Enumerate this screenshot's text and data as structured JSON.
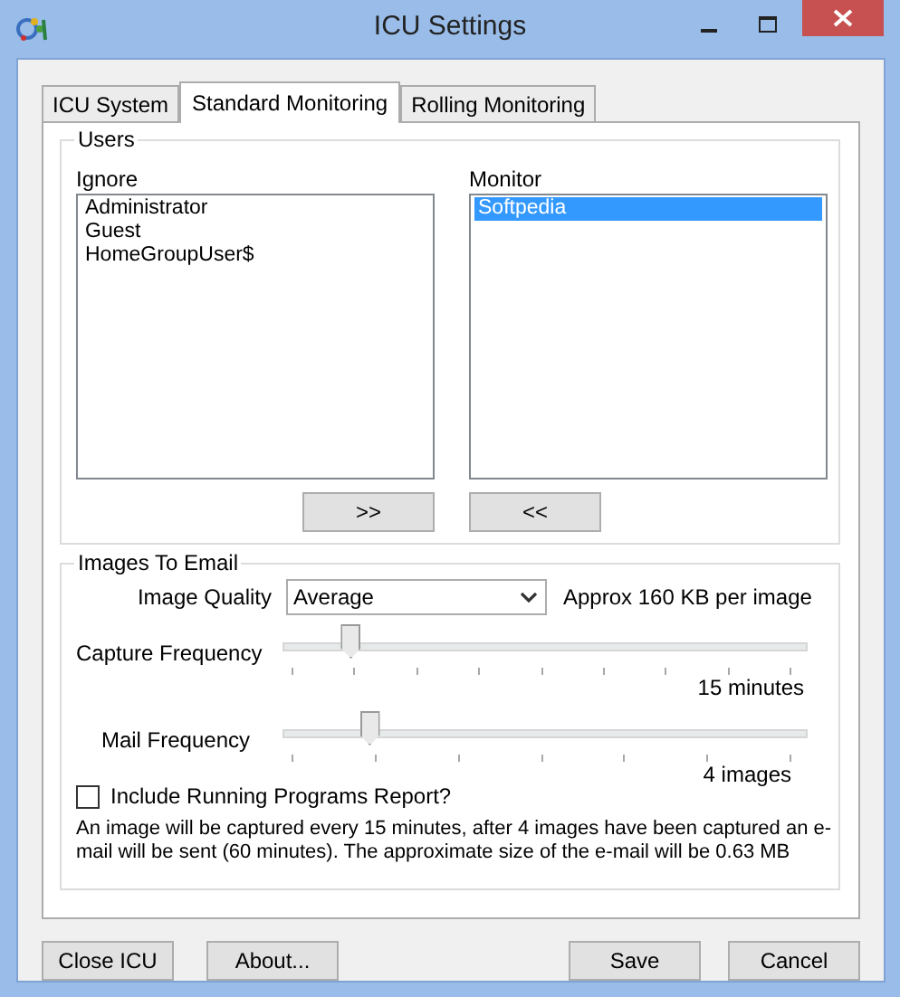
{
  "window": {
    "title": "ICU Settings"
  },
  "tabs": [
    {
      "label": "ICU System",
      "selected": false
    },
    {
      "label": "Standard Monitoring",
      "selected": true
    },
    {
      "label": "Rolling Monitoring",
      "selected": false
    }
  ],
  "users": {
    "title": "Users",
    "ignore": {
      "label": "Ignore",
      "items": [
        {
          "text": "Administrator",
          "selected": false
        },
        {
          "text": "Guest",
          "selected": false
        },
        {
          "text": "HomeGroupUser$",
          "selected": false
        }
      ]
    },
    "monitor": {
      "label": "Monitor",
      "items": [
        {
          "text": "Softpedia",
          "selected": true
        }
      ]
    },
    "add_button": ">>",
    "remove_button": "<<"
  },
  "images": {
    "title": "Images To Email",
    "quality": {
      "label": "Image Quality",
      "value": "Average",
      "note": "Approx 160 KB per image"
    },
    "sliders": [
      {
        "label": "Capture Frequency",
        "level": 0.125,
        "reading": "15 minutes"
      },
      {
        "label": "Mail Frequency",
        "level": 0.16,
        "reading": "4 images"
      }
    ],
    "report": {
      "label": "Include Running Programs Report?",
      "checked": false
    },
    "summary": "An image will be captured every 15 minutes, after 4 images have been captured an e-mail will be sent (60 minutes).  The approximate size of the e-mail will be 0.63 MB"
  },
  "buttons_left": [
    "Close ICU",
    "About..."
  ],
  "buttons_right": [
    "Save",
    "Cancel"
  ]
}
